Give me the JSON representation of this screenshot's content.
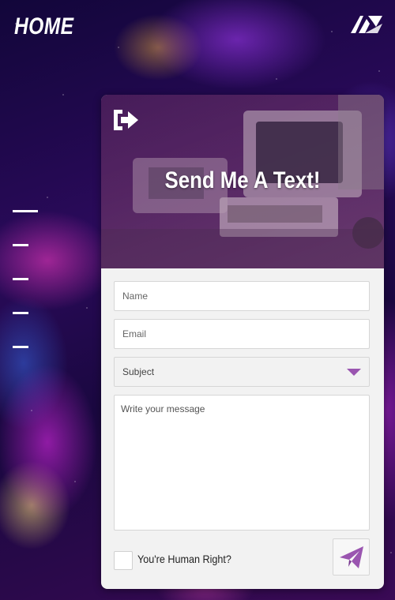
{
  "header": {
    "title": "HOME",
    "logo_icon": "brand-logo-icon"
  },
  "nav": {
    "menu_icon": "hamburger-menu-icon",
    "items": [
      "",
      "",
      "",
      "",
      ""
    ]
  },
  "contact_card": {
    "title": "Send Me A Text!",
    "exit_icon": "sign-out-icon",
    "name_placeholder": "Name",
    "email_placeholder": "Email",
    "subject_value": "Subject",
    "message_placeholder": "Write your message",
    "human_check_label": "You're Human Right?",
    "send_icon": "paper-plane-icon"
  },
  "colors": {
    "accent": "#9a55b0",
    "card_bg": "#f2f2f2"
  }
}
